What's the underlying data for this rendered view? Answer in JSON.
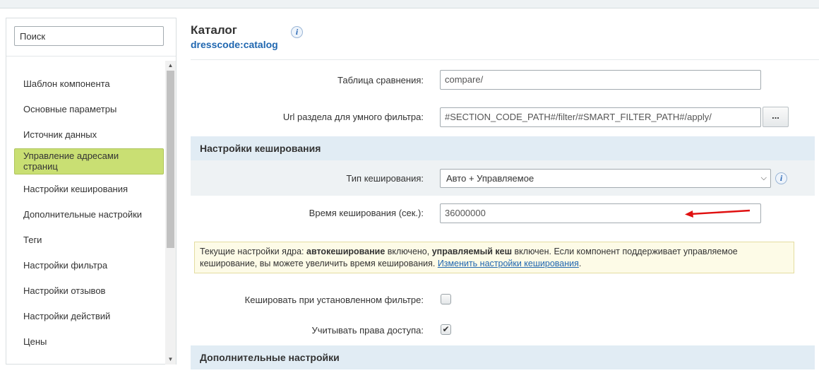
{
  "sidebar": {
    "search_placeholder": "Поиск",
    "items": [
      {
        "label": "Шаблон компонента"
      },
      {
        "label": "Основные параметры"
      },
      {
        "label": "Источник данных"
      },
      {
        "label": "Управление адресами страниц",
        "active": true
      },
      {
        "label": "Настройки кеширования"
      },
      {
        "label": "Дополнительные настройки"
      },
      {
        "label": "Теги"
      },
      {
        "label": "Настройки фильтра"
      },
      {
        "label": "Настройки отзывов"
      },
      {
        "label": "Настройки действий"
      },
      {
        "label": "Цены"
      }
    ]
  },
  "header": {
    "title": "Каталог",
    "subtitle": "dresscode:catalog"
  },
  "fields": {
    "compare": {
      "label": "Таблица сравнения:",
      "value": "compare/"
    },
    "smart_filter": {
      "label": "Url раздела для умного фильтра:",
      "value": "#SECTION_CODE_PATH#/filter/#SMART_FILTER_PATH#/apply/",
      "button": "..."
    }
  },
  "cache_section": {
    "title": "Настройки кеширования",
    "cache_type": {
      "label": "Тип кеширования:",
      "value": "Авто + Управляемое"
    },
    "cache_time": {
      "label": "Время кеширования (сек.):",
      "value": "36000000"
    },
    "note": {
      "t1": "Текущие настройки ядра: ",
      "b1": "автокеширование",
      "t2": " включено, ",
      "b2": "управляемый кеш",
      "t3": " включен. Если компонент поддерживает управляемое кеширование, вы можете увеличить время кеширования. ",
      "link": "Изменить настройки кеширования",
      "t4": "."
    },
    "cache_filter": {
      "label": "Кешировать при установленном фильтре:",
      "checked": false
    },
    "access_rights": {
      "label": "Учитывать права доступа:",
      "checked": true
    }
  },
  "extra_section": {
    "title": "Дополнительные настройки"
  },
  "colors": {
    "active_item": "#c9df73",
    "section_header": "#e1ecf4",
    "link": "#2067b0",
    "annotation_arrow": "#e01010"
  }
}
